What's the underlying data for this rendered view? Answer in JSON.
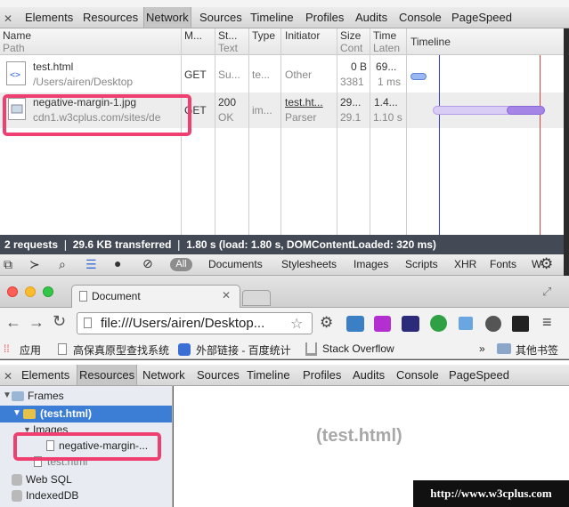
{
  "top_devtools": {
    "tabs": [
      "Elements",
      "Resources",
      "Network",
      "Sources",
      "Timeline",
      "Profiles",
      "Audits",
      "Console",
      "PageSpeed"
    ],
    "columns": [
      {
        "line1": "Name",
        "line2": "Path"
      },
      {
        "line1": "M...",
        "line2": ""
      },
      {
        "line1": "St...",
        "line2": "Text"
      },
      {
        "line1": "Type",
        "line2": ""
      },
      {
        "line1": "Initiator",
        "line2": ""
      },
      {
        "line1": "Size",
        "line2": "Cont"
      },
      {
        "line1": "Time",
        "line2": "Laten"
      },
      {
        "line1": "Timeline",
        "line2": ""
      }
    ],
    "rows": [
      {
        "name": "test.html",
        "path": "/Users/airen/Desktop",
        "method": "GET",
        "status": "Su...",
        "status_text": "",
        "type": "te...",
        "initiator": "Other",
        "initiator2": "",
        "size": "0 B",
        "content": "3381",
        "time": "69...",
        "latency": "1 ms"
      },
      {
        "name": "negative-margin-1.jpg",
        "path": "cdn1.w3cplus.com/sites/de",
        "method": "GET",
        "status": "200",
        "status_text": "OK",
        "type": "im...",
        "initiator": "test.ht...",
        "initiator2": "Parser",
        "size": "29...",
        "content": "29.1",
        "time": "1.4...",
        "latency": "1.10 s"
      }
    ],
    "status_bar": "2 requests  ❘  29.6 KB transferred  ❘  1.80 s (load: 1.80 s, DOMContentLoaded: 320 ms)",
    "filter": {
      "all": "All",
      "items": [
        "Documents",
        "Stylesheets",
        "Images",
        "Scripts",
        "XHR",
        "Fonts",
        "W"
      ]
    }
  },
  "browser": {
    "tab_title": "Document",
    "url": "file:///Users/airen/Desktop...",
    "bookmarks": [
      "应用",
      "高保真原型查找系统",
      "外部链接 - 百度统计",
      "Stack Overflow",
      "»",
      "其他书签"
    ],
    "devtools_tabs": [
      "Elements",
      "Resources",
      "Network",
      "Sources",
      "Timeline",
      "Profiles",
      "Audits",
      "Console",
      "PageSpeed"
    ],
    "tree": {
      "frames": "Frames",
      "frame_item": "(test.html)",
      "images": "Images",
      "image_file": "negative-margin-...",
      "test_html": "test.html",
      "web_sql": "Web SQL",
      "indexeddb": "IndexedDB"
    },
    "main_label": "(test.html)"
  },
  "watermark": "http://www.w3cplus.com",
  "colors": {
    "highlight": "#ee3f70",
    "timeline_blue": "#3a3fd6",
    "timeline_red": "#e04040",
    "bar_purple": "#b49be6"
  }
}
